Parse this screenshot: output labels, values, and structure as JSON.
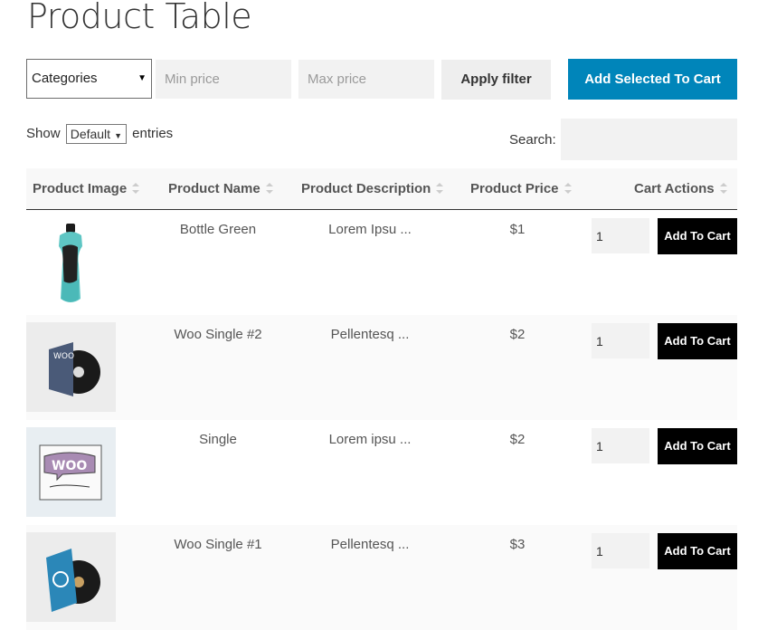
{
  "page": {
    "title": "Product Table"
  },
  "filters": {
    "category_select": "Categories",
    "min_price_placeholder": "Min price",
    "max_price_placeholder": "Max price",
    "apply_label": "Apply filter",
    "add_selected_label": "Add Selected To Cart"
  },
  "table_controls": {
    "show_label": "Show",
    "entries_value": "Default",
    "entries_label": "entries",
    "search_label": "Search:"
  },
  "columns": [
    "Product Image",
    "Product Name",
    "Product Description",
    "Product Price",
    "Cart Actions"
  ],
  "rows": [
    {
      "name": "Bottle Green",
      "description": "Lorem Ipsu ...",
      "price": "$1",
      "qty": "1",
      "action": "Add To Cart",
      "image": "water-bottle-image"
    },
    {
      "name": "Woo Single #2",
      "description": "Pellentesq ...",
      "price": "$2",
      "qty": "1",
      "action": "Add To Cart",
      "image": "album-woo-image"
    },
    {
      "name": "Single",
      "description": "Lorem ipsu ...",
      "price": "$2",
      "qty": "1",
      "action": "Add To Cart",
      "image": "woo-sketch-image"
    },
    {
      "name": "Woo Single #1",
      "description": "Pellentesq ...",
      "price": "$3",
      "qty": "1",
      "action": "Add To Cart",
      "image": "album-blue-image"
    }
  ],
  "colors": {
    "primary": "#0085ba",
    "cart_button": "#000000"
  }
}
